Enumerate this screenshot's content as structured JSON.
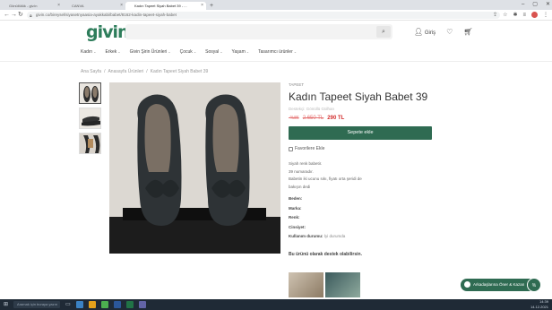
{
  "browser": {
    "tabs": [
      {
        "label": "Gönüllülük - giv.in",
        "active": false
      },
      {
        "label": "CANVA",
        "active": false
      },
      {
        "label": "Kadın Tapeet Siyah Babet 39 - ...",
        "active": true
      }
    ],
    "new_tab": "+",
    "url": "givin.co/bireysel/siyasetnyaasia-ayakkabi/babet/8162-kadin-tapeet-siyah-babet"
  },
  "header": {
    "logo": "givin",
    "search_placeholder": "",
    "login_label": "Giriş",
    "icons": {
      "search": "search-icon",
      "user": "user-icon",
      "favorites": "heart-icon",
      "cart": "cart-icon"
    }
  },
  "categories": [
    "Kadın",
    "Erkek",
    "Givin Şirin Ürünleri",
    "Çocuk",
    "Sosyal",
    "Yaşam",
    "Tasarımcı ürünler"
  ],
  "breadcrumb": [
    "Ana Sayfa",
    "/",
    "Anasayfa Ürünleri",
    "/",
    "Kadın Tapeet Siyah Babet 39"
  ],
  "product": {
    "brand": "TAPEET",
    "title": "Kadın Tapeet Siyah Babet 39",
    "seller_label": "Destekçi:",
    "seller_name": "Gönüllü Gülhan",
    "discount": "-%86",
    "old_price": "2.650 TL",
    "price": "290 TL",
    "add_to_cart": "Sepete ekle",
    "favorite_label": "Favorilere Ekle",
    "description": [
      "Siyah renk babetir.",
      "39 numaradır.",
      "Babetin iki ucunu sıkı, fiyatı orta şeridi de",
      "bakışın dedi"
    ],
    "attributes": [
      {
        "label": "Beden:",
        "value": ""
      },
      {
        "label": "Marka:",
        "value": ""
      },
      {
        "label": "Renk:",
        "value": ""
      },
      {
        "label": "Cinsiyet:",
        "value": ""
      },
      {
        "label": "Kullanım durumu:",
        "value": "İyi durumda"
      }
    ],
    "support_text": "Bu ürünü olarak destek olabilirsin."
  },
  "chat": {
    "label": "Arkadaşlarına Öner & Kazan",
    "badge": "%"
  },
  "taskbar": {
    "search_placeholder": "Aramak için buraya yazın",
    "time": "14:39",
    "date": "14.12.2021"
  }
}
